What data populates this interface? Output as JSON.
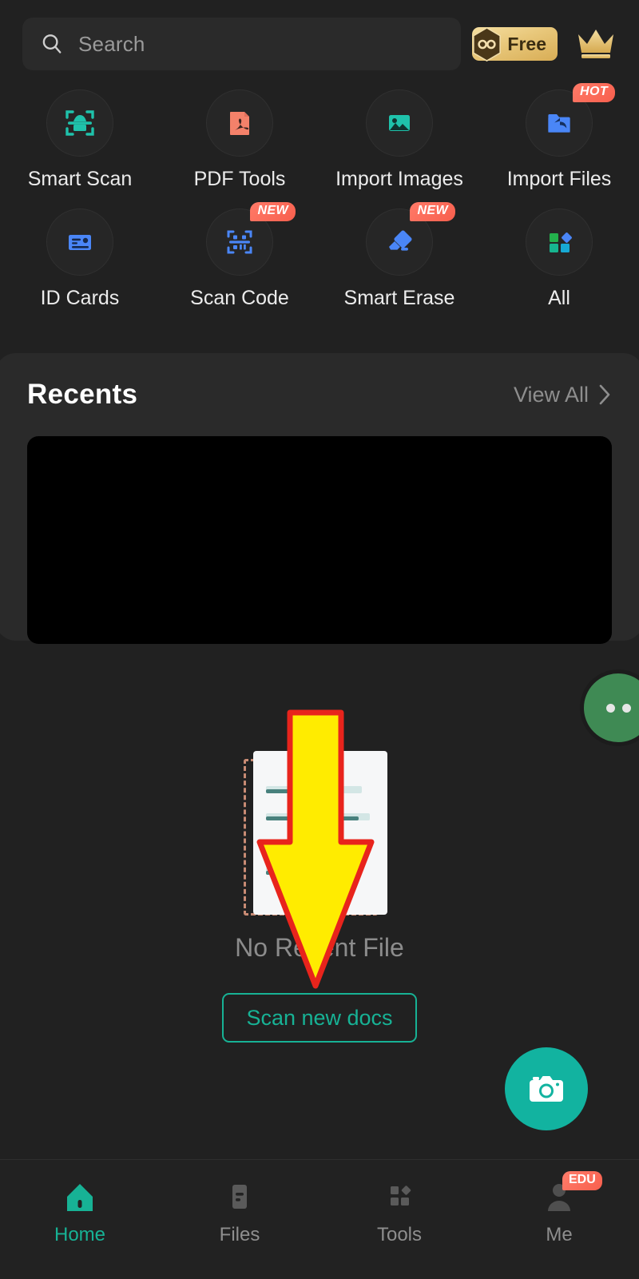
{
  "colors": {
    "background": "#212121",
    "card": "#2a2a2a",
    "accent_teal": "#17b295",
    "accent_blue": "#4a86f7",
    "badge_red": "#f85f4d",
    "gold": "#e8c77a",
    "annotation_yellow": "#ffec00",
    "annotation_outline": "#e8241c"
  },
  "search": {
    "placeholder": "Search",
    "value": "",
    "icon": "search-icon"
  },
  "header": {
    "free_badge_label": "Free",
    "free_badge_icon": "infinity-hex-icon",
    "crown_icon": "crown-icon"
  },
  "tools": [
    {
      "label": "Smart Scan",
      "icon": "smart-scan-icon",
      "badge": ""
    },
    {
      "label": "PDF Tools",
      "icon": "pdf-file-icon",
      "badge": ""
    },
    {
      "label": "Import Images",
      "icon": "image-icon",
      "badge": ""
    },
    {
      "label": "Import Files",
      "icon": "folder-import-icon",
      "badge": "HOT"
    },
    {
      "label": "ID Cards",
      "icon": "id-card-icon",
      "badge": ""
    },
    {
      "label": "Scan Code",
      "icon": "qr-scan-icon",
      "badge": "NEW"
    },
    {
      "label": "Smart Erase",
      "icon": "eraser-icon",
      "badge": "NEW"
    },
    {
      "label": "All",
      "icon": "grid-squares-icon",
      "badge": ""
    }
  ],
  "recents": {
    "title": "Recents",
    "view_all_label": "View All",
    "chevron_icon": "chevron-right-icon",
    "thumbnail_state": "black"
  },
  "side_fab": {
    "icon": "more-dots-icon"
  },
  "empty_state": {
    "illustration": "empty-document-icon",
    "message": "No Recent File",
    "action_label": "Scan new docs"
  },
  "annotation": {
    "type": "down-arrow",
    "color": "#ffec00",
    "outline": "#e8241c"
  },
  "camera_fab": {
    "icon": "camera-icon"
  },
  "bottom_nav": {
    "items": [
      {
        "label": "Home",
        "icon": "home-icon",
        "badge": "",
        "active": true
      },
      {
        "label": "Files",
        "icon": "files-icon",
        "badge": "",
        "active": false
      },
      {
        "label": "Tools",
        "icon": "tools-icon",
        "badge": "",
        "active": false
      },
      {
        "label": "Me",
        "icon": "person-icon",
        "badge": "EDU",
        "active": false
      }
    ]
  }
}
